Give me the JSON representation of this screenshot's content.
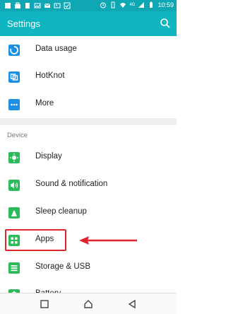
{
  "status_bar": {
    "time": "10:59",
    "network": "4G"
  },
  "app_bar": {
    "title": "Settings"
  },
  "items_top": [
    {
      "label": "Data usage",
      "icon": "data-usage-icon",
      "color": "#1a8fe6"
    },
    {
      "label": "HotKnot",
      "icon": "hotknot-icon",
      "color": "#1a8fe6"
    },
    {
      "label": "More",
      "icon": "more-icon",
      "color": "#1a8fe6"
    }
  ],
  "section": {
    "title": "Device"
  },
  "items_device": [
    {
      "label": "Display",
      "icon": "display-icon",
      "color": "#2dbb5a"
    },
    {
      "label": "Sound & notification",
      "icon": "sound-icon",
      "color": "#2dbb5a"
    },
    {
      "label": "Sleep cleanup",
      "icon": "sleep-cleanup-icon",
      "color": "#2dbb5a"
    },
    {
      "label": "Apps",
      "icon": "apps-icon",
      "color": "#2dbb5a"
    },
    {
      "label": "Storage & USB",
      "icon": "storage-icon",
      "color": "#2dbb5a"
    },
    {
      "label": "Battery",
      "icon": "battery-icon",
      "color": "#2dbb5a"
    }
  ],
  "colors": {
    "accent": "#0fb5c1",
    "status_bar": "#0fa7b4",
    "highlight": "#e0242b"
  }
}
